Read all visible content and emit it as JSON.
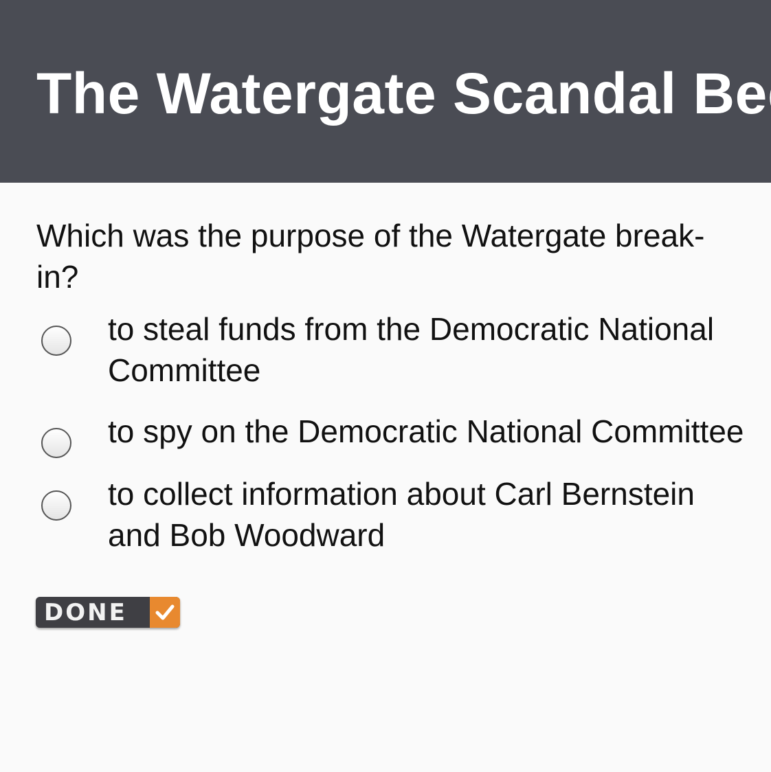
{
  "header": {
    "title": "The Watergate Scandal Begins"
  },
  "question": {
    "text": "Which was the purpose of the Watergate break-in?"
  },
  "options": [
    {
      "label": "to steal funds from the Democratic National Committee"
    },
    {
      "label": "to spy on the Democratic National Committee"
    },
    {
      "label": "to collect information about Carl Bernstein and Bob Woodward"
    }
  ],
  "done_button": {
    "label": "DONE",
    "icon": "checkmark-icon",
    "accent_color": "#e8892f"
  },
  "colors": {
    "header_background": "#4a4c54",
    "page_background": "#fafafa",
    "header_text": "#ffffff",
    "body_text": "#111111"
  }
}
